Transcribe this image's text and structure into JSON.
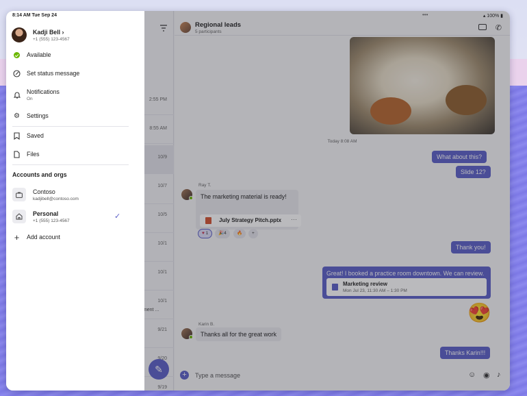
{
  "status_bar": {
    "time": "8:14 AM  Tue Sep 24",
    "battery": "100%"
  },
  "profile": {
    "name": "Kadji Bell",
    "chevron": "›",
    "phone": "+1 (555) 123-4567"
  },
  "menu": {
    "available": "Available",
    "set_status": "Set status message",
    "notifications": "Notifications",
    "notifications_sub": "On",
    "settings": "Settings",
    "saved": "Saved",
    "files": "Files"
  },
  "accounts": {
    "title": "Accounts and orgs",
    "items": [
      {
        "name": "Contoso",
        "sub": "kadjibell@contoso.com",
        "selected": false,
        "bold": false
      },
      {
        "name": "Personal",
        "sub": "+1 (555) 123-4567",
        "selected": true,
        "bold": true
      }
    ],
    "add": "Add account"
  },
  "list_times": [
    "2:55 PM",
    "8:55 AM",
    "10/9",
    "10/7",
    "10/5",
    "10/1",
    "10/1",
    "10/1",
    "9/21",
    "9/20",
    "9/19"
  ],
  "list_snippet": "tment ...",
  "chat": {
    "title": "Regional leads",
    "subtitle": "5 participants",
    "timestamp": "Today 8:08 AM",
    "me_1": "What about this?",
    "me_2": "Slide 12?",
    "sender_1": "Ray T.",
    "msg_1": "The marketing material is ready!",
    "file_name": "July Strategy Pitch.pptx",
    "file_more": "···",
    "reactions": [
      {
        "emoji": "♥",
        "count": "1",
        "active": true
      },
      {
        "emoji": "🎉",
        "count": "4",
        "active": false
      },
      {
        "emoji": "🔥",
        "count": "",
        "active": false
      },
      {
        "emoji": "+",
        "count": "",
        "active": false
      }
    ],
    "me_3": "Thank you!",
    "me_4": "Great! I booked a practice room downtown. We can review.",
    "event_title": "Marketing review",
    "event_time": "Mon Jul 23, 11:30 AM – 1:30 PM",
    "emoji_reaction": "😍",
    "sender_2": "Karin B.",
    "msg_2": "Thanks all for the great work",
    "me_5": "Thanks Karin!!!",
    "composer_placeholder": "Type a message"
  },
  "colors": {
    "accent": "#5b5fc7",
    "presence": "#6bb700"
  }
}
